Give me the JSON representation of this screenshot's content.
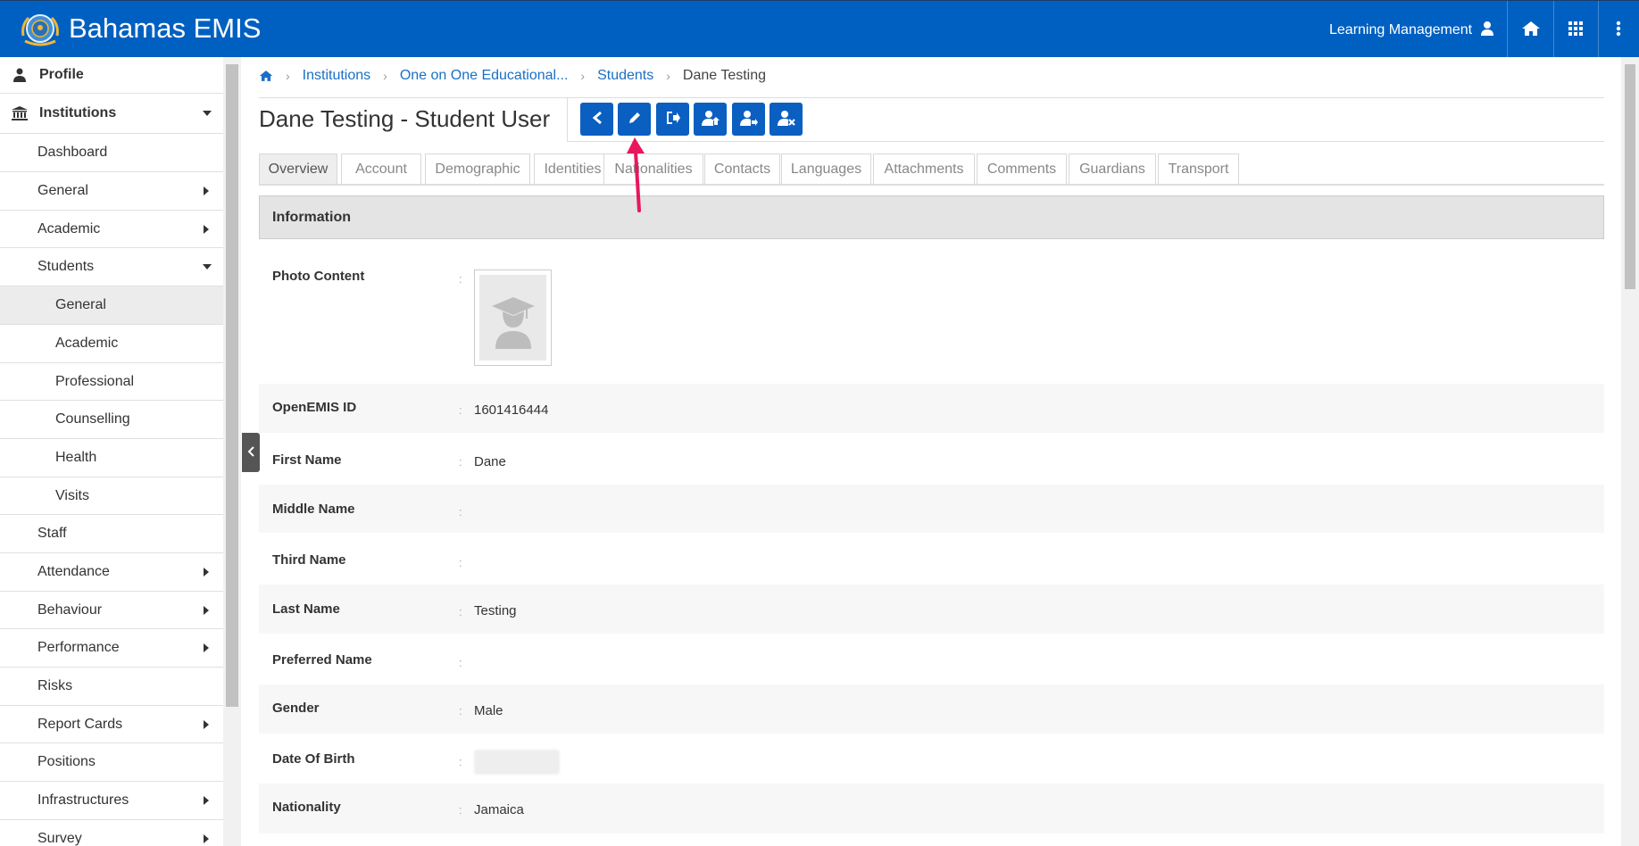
{
  "header": {
    "app_title": "Bahamas EMIS",
    "user_label": "Learning Management",
    "icons": [
      "emblem-logo",
      "user-icon",
      "home-icon",
      "grid-icon",
      "more-vert-icon"
    ],
    "brand_color": "#0060c1"
  },
  "sidebar": {
    "items": [
      {
        "label": "Profile",
        "icon": "user-icon"
      },
      {
        "label": "Institutions",
        "icon": "institution-icon"
      },
      {
        "label": "Dashboard"
      },
      {
        "label": "General"
      },
      {
        "label": "Academic"
      },
      {
        "label": "Students"
      },
      {
        "label": "General"
      },
      {
        "label": "Academic"
      },
      {
        "label": "Professional"
      },
      {
        "label": "Counselling"
      },
      {
        "label": "Health"
      },
      {
        "label": "Visits"
      },
      {
        "label": "Staff"
      },
      {
        "label": "Attendance"
      },
      {
        "label": "Behaviour"
      },
      {
        "label": "Performance"
      },
      {
        "label": "Risks"
      },
      {
        "label": "Report Cards"
      },
      {
        "label": "Positions"
      },
      {
        "label": "Infrastructures"
      },
      {
        "label": "Survey"
      }
    ],
    "active_item": "General"
  },
  "breadcrumb": {
    "items": [
      "Institutions",
      "One on One Educational...",
      "Students",
      "Dane Testing"
    ]
  },
  "page": {
    "title": "Dane Testing - Student User",
    "toolbar_icons": [
      "back-icon",
      "edit-icon",
      "exit-icon",
      "promote-user-icon",
      "transfer-user-icon",
      "remove-user-icon"
    ]
  },
  "tabs": [
    "Overview",
    "Account",
    "Demographic",
    "Identities",
    "Nationalities",
    "Contacts",
    "Languages",
    "Attachments",
    "Comments",
    "Guardians",
    "Transport"
  ],
  "active_tab": "Overview",
  "panel": {
    "title": "Information"
  },
  "fields": [
    {
      "label": "Photo Content",
      "value": ""
    },
    {
      "label": "OpenEMIS ID",
      "value": "1601416444"
    },
    {
      "label": "First Name",
      "value": "Dane"
    },
    {
      "label": "Middle Name",
      "value": ""
    },
    {
      "label": "Third Name",
      "value": ""
    },
    {
      "label": "Last Name",
      "value": "Testing"
    },
    {
      "label": "Preferred Name",
      "value": ""
    },
    {
      "label": "Gender",
      "value": "Male"
    },
    {
      "label": "Date Of Birth",
      "value": ""
    },
    {
      "label": "Nationality",
      "value": "Jamaica"
    }
  ],
  "colon": ":",
  "annotation_color": "#e8175d"
}
